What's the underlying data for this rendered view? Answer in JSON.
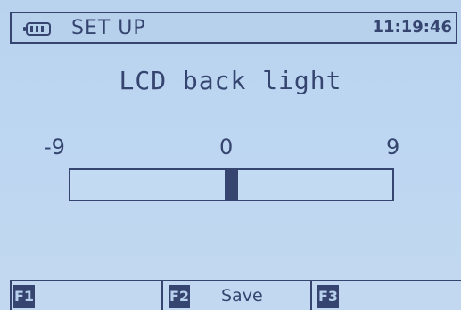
{
  "header": {
    "title": "SET UP",
    "time": "11:19:46",
    "battery_icon": "battery-icon"
  },
  "main": {
    "setting_name": "LCD back light",
    "scale": {
      "min_label": "-9",
      "mid_label": "0",
      "max_label": "9",
      "min": -9,
      "max": 9,
      "value": 0
    }
  },
  "footer": {
    "keys": [
      {
        "key": "F1",
        "label": ""
      },
      {
        "key": "F2",
        "label": "Save"
      },
      {
        "key": "F3",
        "label": ""
      }
    ]
  },
  "colors": {
    "lcd_background": "#bdd6f1",
    "foreground": "#35456f"
  }
}
